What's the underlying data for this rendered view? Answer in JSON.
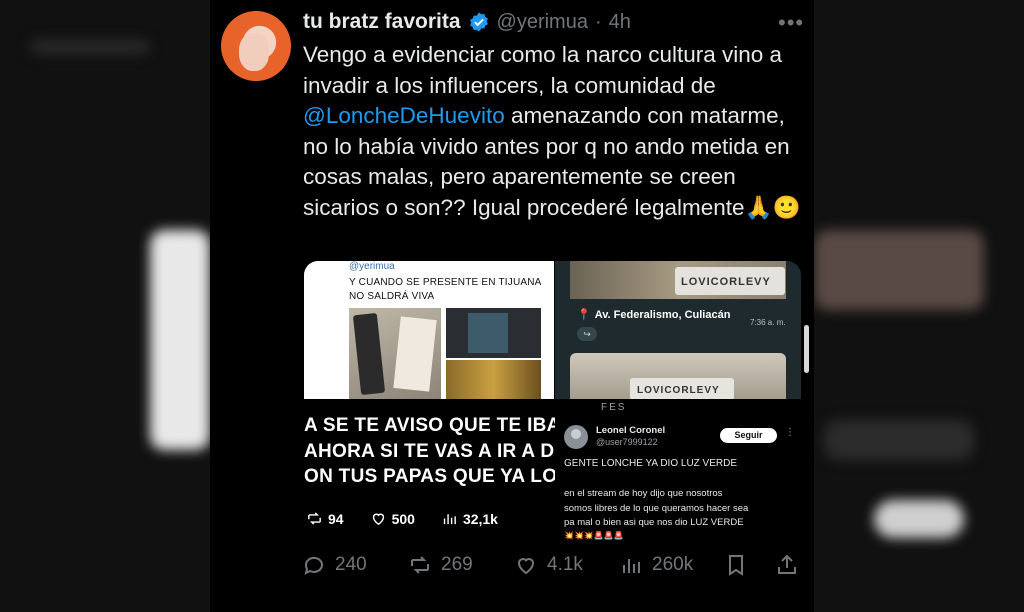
{
  "tweet": {
    "display_name": "tu bratz favorita",
    "handle": "@yerimua",
    "separator": "·",
    "time": "4h",
    "more_label": "•••",
    "text_before_mention": "Vengo a evidenciar como la narco cultura vino a invadir a los influencers, la comunidad de",
    "mention": "@LoncheDeHuevito",
    "text_after_mention": " amenazando con matarme, no lo había vivido antes por q no ando metida en cosas malas, pero aparentemente se creen sicarios o son?? Igual procederé legalmente",
    "emojis": "🙏🙂"
  },
  "media": {
    "panel1": {
      "handle": "@yerimua",
      "caption_line1": "Y CUANDO SE PRESENTE EN TIJUANA",
      "caption_line2": "NO SALDRÁ VIVA"
    },
    "panel3": {
      "big_lines": [
        "A SE TE AVISO QUE TE IBA A",
        "AHORA SI TE VAS A IR A DO",
        "ON TUS PAPAS QUE YA LOS"
      ],
      "stats": {
        "retweets": "94",
        "likes": "500",
        "views": "32,1k"
      }
    },
    "panel2": {
      "logo": "LOVICORLEVY",
      "address": "Av. Federalismo, Culiacán",
      "msg_time": "7:36 a. m.",
      "share": "↪"
    },
    "panel4": {
      "label": "FES",
      "user_name": "Leonel Coronel",
      "user_handle": "@user7999122",
      "follow_label": "Seguir",
      "more": "⋮",
      "line1": "GENTE LONCHE YA DIO LUZ VERDE",
      "line2": "en el stream de hoy dijo que nosotros",
      "line3": "somos libres de lo que queramos hacer sea",
      "line4": "pa mal o bien asi que nos dio LUZ VERDE",
      "emoji_row": "💥💥💥🚨🚨🚨"
    }
  },
  "actions": {
    "replies": "240",
    "retweets": "269",
    "likes": "4.1k",
    "views": "260k"
  },
  "colors": {
    "accent": "#1d9bf0",
    "muted": "#71767b",
    "background": "#000000"
  }
}
